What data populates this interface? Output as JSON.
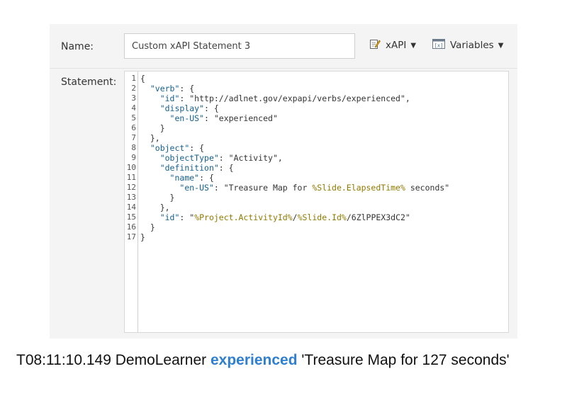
{
  "form": {
    "name_label": "Name:",
    "name_value": "Custom xAPI Statement 3",
    "statement_label": "Statement:",
    "xapi_menu_label": "xAPI",
    "variables_menu_label": "Variables"
  },
  "editor": {
    "line_numbers": [
      "1",
      "2",
      "3",
      "4",
      "5",
      "6",
      "7",
      "8",
      "9",
      "10",
      "11",
      "12",
      "13",
      "14",
      "15",
      "16",
      "17"
    ],
    "lines": [
      [
        {
          "t": "{",
          "c": "v"
        }
      ],
      [
        {
          "t": "  ",
          "c": "v"
        },
        {
          "t": "\"verb\"",
          "c": "k"
        },
        {
          "t": ": {",
          "c": "v"
        }
      ],
      [
        {
          "t": "    ",
          "c": "v"
        },
        {
          "t": "\"id\"",
          "c": "k"
        },
        {
          "t": ": \"http://adlnet.gov/expapi/verbs/experienced\",",
          "c": "v"
        }
      ],
      [
        {
          "t": "    ",
          "c": "v"
        },
        {
          "t": "\"display\"",
          "c": "k"
        },
        {
          "t": ": {",
          "c": "v"
        }
      ],
      [
        {
          "t": "      ",
          "c": "v"
        },
        {
          "t": "\"en-US\"",
          "c": "k"
        },
        {
          "t": ": \"experienced\"",
          "c": "v"
        }
      ],
      [
        {
          "t": "    }",
          "c": "v"
        }
      ],
      [
        {
          "t": "  },",
          "c": "v"
        }
      ],
      [
        {
          "t": "  ",
          "c": "v"
        },
        {
          "t": "\"object\"",
          "c": "k"
        },
        {
          "t": ": {",
          "c": "v"
        }
      ],
      [
        {
          "t": "    ",
          "c": "v"
        },
        {
          "t": "\"objectType\"",
          "c": "k"
        },
        {
          "t": ": \"Activity\",",
          "c": "v"
        }
      ],
      [
        {
          "t": "    ",
          "c": "v"
        },
        {
          "t": "\"definition\"",
          "c": "k"
        },
        {
          "t": ": {",
          "c": "v"
        }
      ],
      [
        {
          "t": "      ",
          "c": "v"
        },
        {
          "t": "\"name\"",
          "c": "k"
        },
        {
          "t": ": {",
          "c": "v"
        }
      ],
      [
        {
          "t": "        ",
          "c": "v"
        },
        {
          "t": "\"en-US\"",
          "c": "k"
        },
        {
          "t": ": \"Treasure Map for ",
          "c": "v"
        },
        {
          "t": "%Slide.ElapsedTime%",
          "c": "t"
        },
        {
          "t": " seconds\"",
          "c": "v"
        }
      ],
      [
        {
          "t": "      }",
          "c": "v"
        }
      ],
      [
        {
          "t": "    },",
          "c": "v"
        }
      ],
      [
        {
          "t": "    ",
          "c": "v"
        },
        {
          "t": "\"id\"",
          "c": "k"
        },
        {
          "t": ": \"",
          "c": "v"
        },
        {
          "t": "%Project.ActivityId%",
          "c": "t"
        },
        {
          "t": "/",
          "c": "v"
        },
        {
          "t": "%Slide.Id%",
          "c": "t"
        },
        {
          "t": "/6ZlPPEX3dC2\"",
          "c": "v"
        }
      ],
      [
        {
          "t": "  }",
          "c": "v"
        }
      ],
      [
        {
          "t": "}",
          "c": "v"
        }
      ]
    ]
  },
  "log": {
    "timestamp": "T08:11:10.149",
    "actor": "DemoLearner",
    "verb": "experienced",
    "object": "'Treasure Map for 127 seconds'"
  },
  "colors": {
    "json_key": "#14608f",
    "json_token": "#917a00",
    "log_verb": "#2f7fd0",
    "panel_bg": "#f4f4f4"
  },
  "icons": {
    "xapi_menu": "edit-document-icon",
    "variables_menu": "variable-box-icon"
  }
}
